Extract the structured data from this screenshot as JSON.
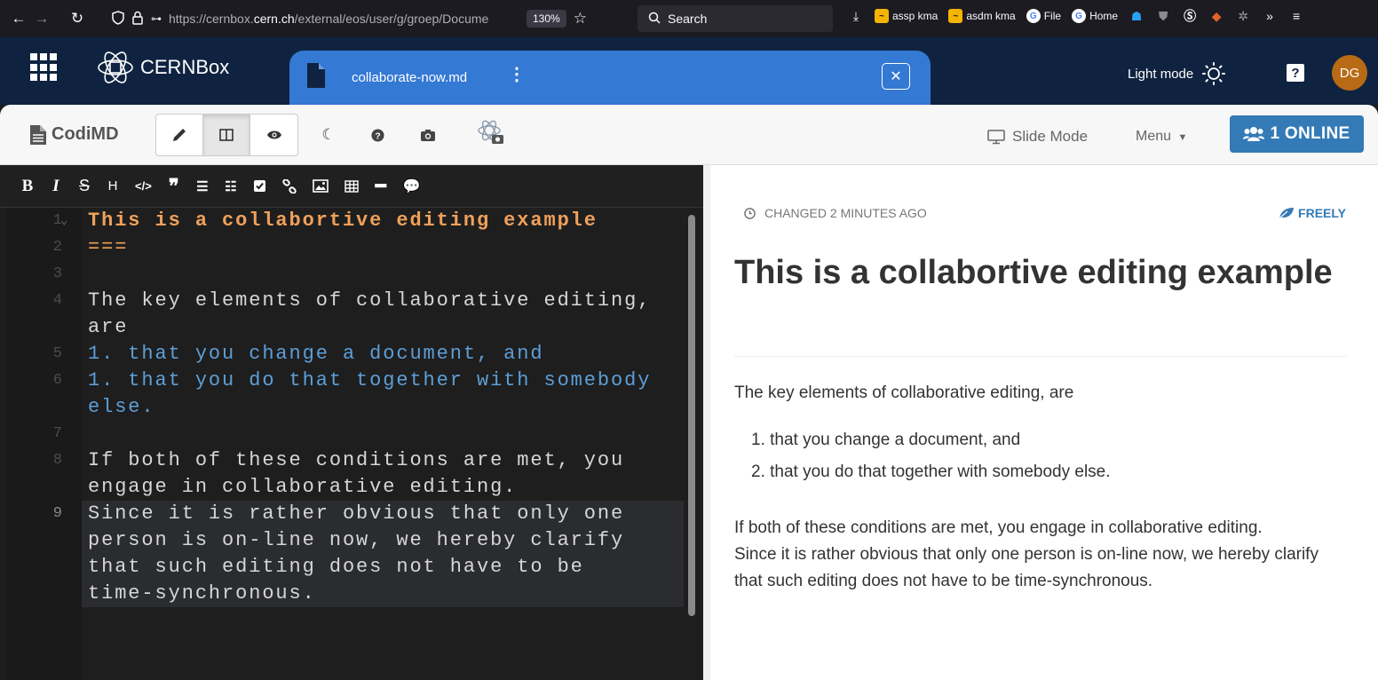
{
  "browser": {
    "url_prefix": "https://cernbox.",
    "url_domain": "cern.ch",
    "url_suffix": "/external/eos/user/g/groep/Docume",
    "zoom": "130%",
    "search_placeholder": "Search",
    "bookmarks": [
      {
        "label": "assp kma",
        "icon": "kma-icon"
      },
      {
        "label": "asdm kma",
        "icon": "kma-icon"
      },
      {
        "label": "File",
        "icon": "google-icon"
      },
      {
        "label": "Home",
        "icon": "google-icon"
      }
    ]
  },
  "cernbox": {
    "brand": "CERNBox",
    "file_name": "collaborate-now.md",
    "theme_label": "Light mode",
    "avatar_initials": "DG"
  },
  "codimd": {
    "brand": "CodiMD",
    "slide_mode": "Slide Mode",
    "menu": "Menu",
    "online": "1 ONLINE"
  },
  "formatting": {
    "bold": "B",
    "italic": "I",
    "strike": "S",
    "heading": "H"
  },
  "editor_lines": [
    {
      "num": "1",
      "text": "This is a collabortive editing example"
    },
    {
      "num": "2",
      "text": "==="
    },
    {
      "num": "3",
      "text": ""
    },
    {
      "num": "4",
      "text": "The key elements of collaborative editing,",
      "cont": "are"
    },
    {
      "num": "5",
      "text": "1. that you change a document, and"
    },
    {
      "num": "6",
      "text": "1. that you do that together with somebody",
      "cont": "else."
    },
    {
      "num": "7",
      "text": ""
    },
    {
      "num": "8",
      "text": "If both of these conditions are met, you",
      "cont": "engage in collaborative editing."
    },
    {
      "num": "9",
      "text": "Since it is rather obvious that only one",
      "cont": "person is on-line now, we hereby clarify",
      "cont2": "that such editing does not have to be",
      "cont3": "time-synchronous."
    }
  ],
  "preview": {
    "changed": "CHANGED 2 MINUTES AGO",
    "permission": "FREELY",
    "title": "This is a collabortive editing example",
    "intro": "The key elements of collaborative editing, are",
    "list": [
      "1. that you change a document, and",
      "2. that you do that together with somebody else."
    ],
    "para1": "If both of these conditions are met, you engage in collaborative editing.",
    "para2": "Since it is rather obvious that only one person is on-line now, we hereby clarify that such editing does not have to be time-synchronous."
  }
}
